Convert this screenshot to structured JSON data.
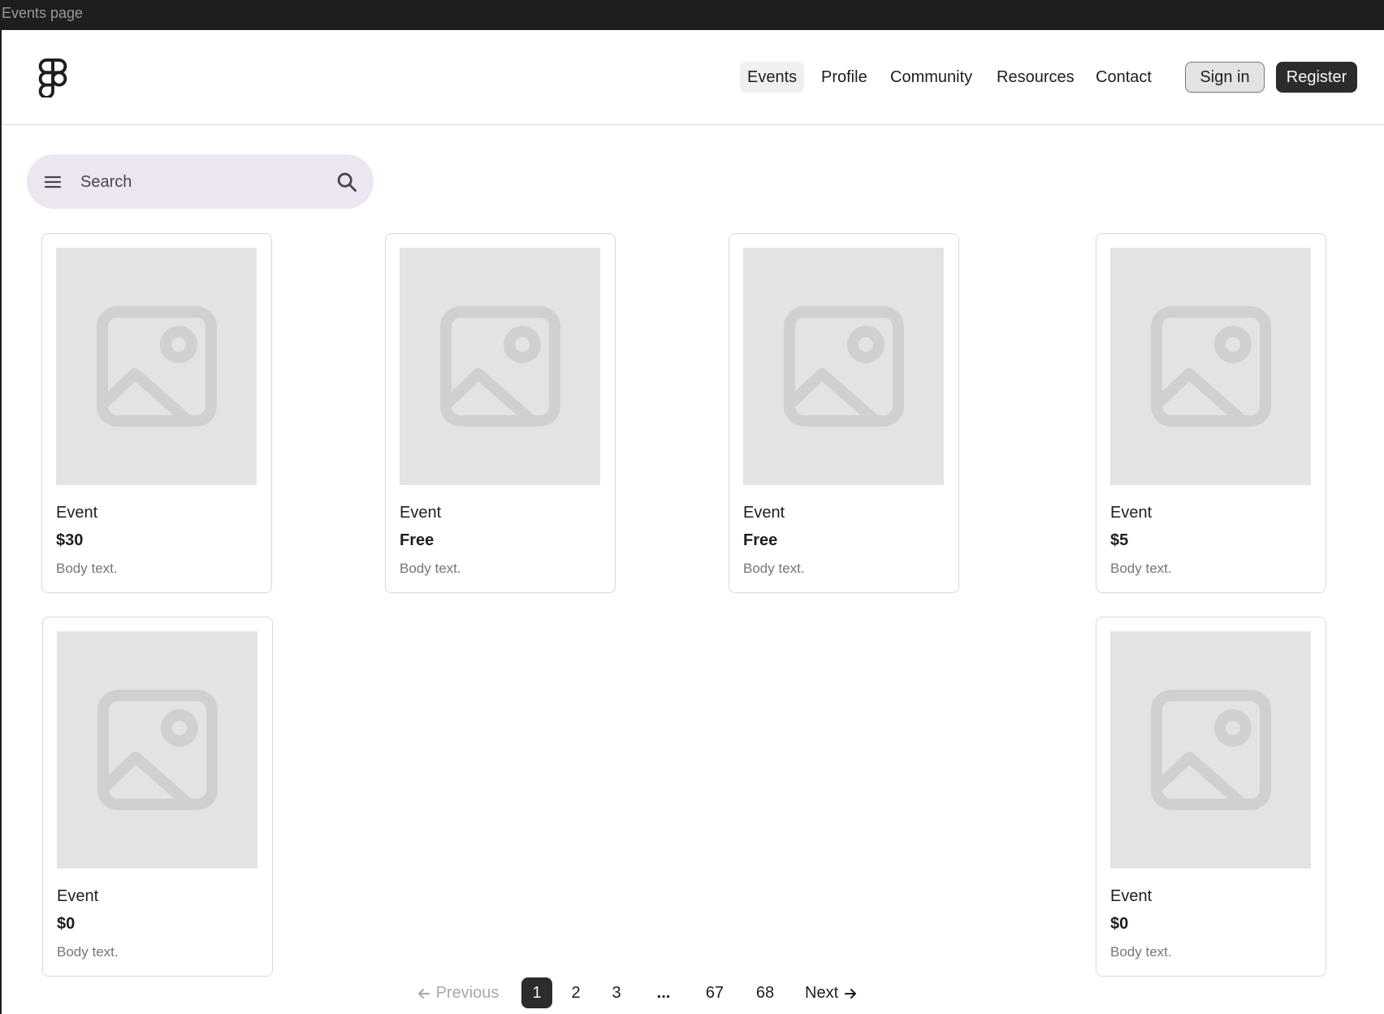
{
  "window": {
    "title": "Events page"
  },
  "header": {
    "logo_icon": "figma-logo-icon",
    "nav": [
      {
        "label": "Events",
        "active": true
      },
      {
        "label": "Profile",
        "active": false
      },
      {
        "label": "Community",
        "active": false
      },
      {
        "label": "Resources",
        "active": false
      },
      {
        "label": "Contact",
        "active": false
      }
    ],
    "sign_in_label": "Sign in",
    "register_label": "Register"
  },
  "search": {
    "placeholder": "Search",
    "value": "",
    "menu_icon": "menu-icon",
    "search_icon": "search-icon"
  },
  "cards": [
    {
      "title": "Event",
      "price": "$30",
      "body": "Body text."
    },
    {
      "title": "Event",
      "price": "Free",
      "body": "Body text."
    },
    {
      "title": "Event",
      "price": "Free",
      "body": "Body text."
    },
    {
      "title": "Event",
      "price": "$5",
      "body": "Body text."
    },
    {
      "title": "Event",
      "price": "$0",
      "body": "Body text."
    },
    {
      "title": "Event",
      "price": "$0",
      "body": "Body text."
    }
  ],
  "pagination": {
    "previous_label": "Previous",
    "next_label": "Next",
    "pages": [
      "1",
      "2",
      "3",
      "...",
      "67",
      "68"
    ],
    "current": "1"
  },
  "colors": {
    "primary_dark": "#2c2c2c",
    "search_bg": "#ece6f0",
    "placeholder_bg": "#e3e3e3",
    "border": "#d9d9d9",
    "muted_text": "#757575"
  }
}
